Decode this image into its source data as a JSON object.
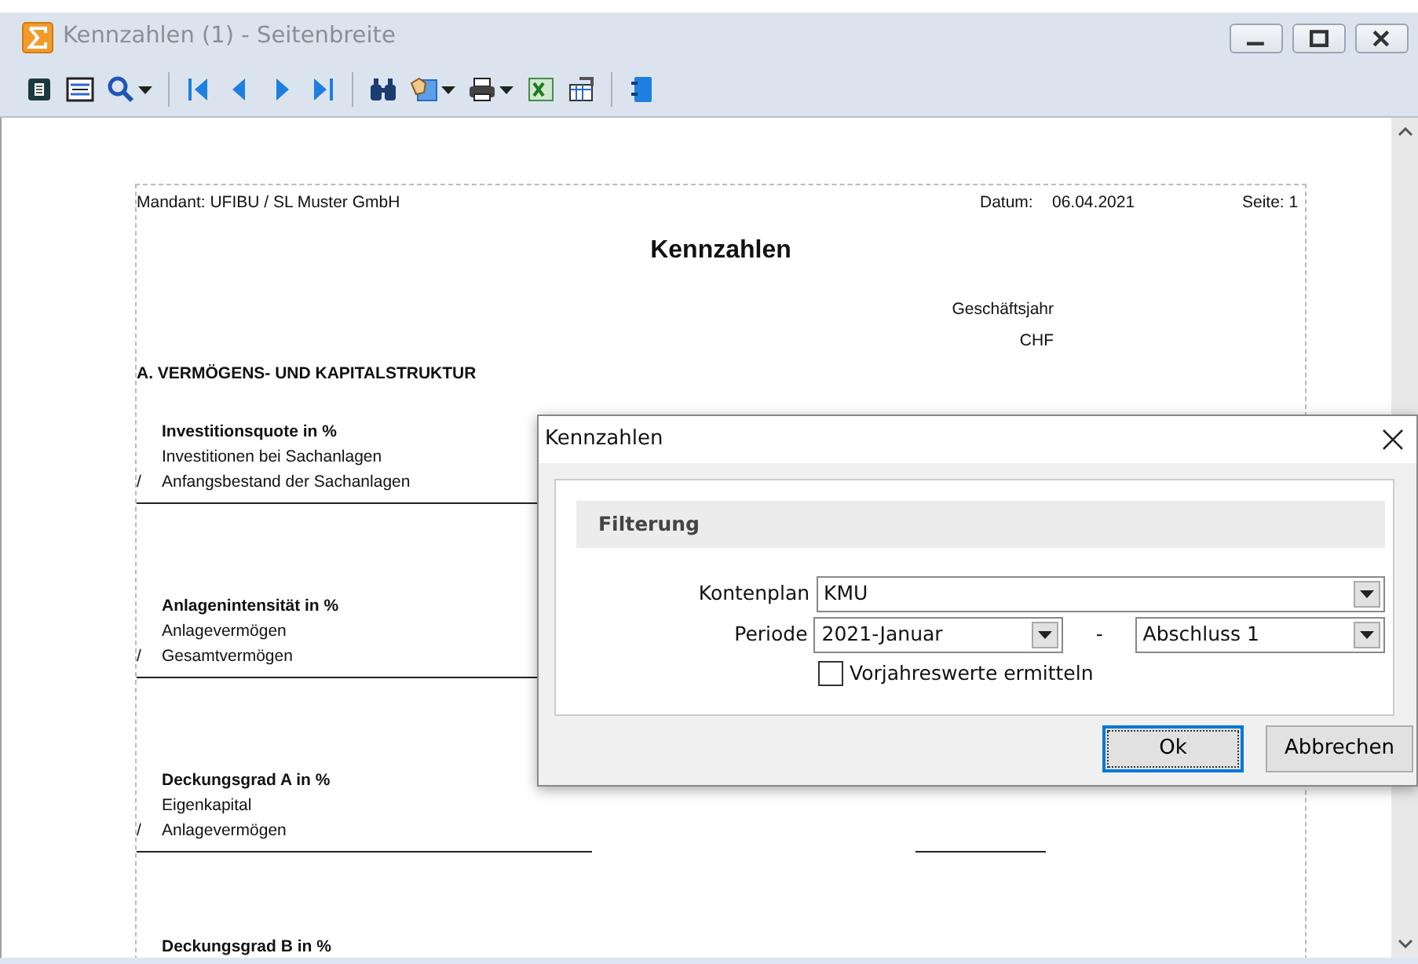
{
  "window": {
    "title": "Kennzahlen (1) - Seitenbreite"
  },
  "toolbar": [
    {
      "kind": "page",
      "menu": false
    },
    {
      "kind": "page-width",
      "menu": false
    },
    {
      "kind": "zoom",
      "menu": true
    },
    {
      "kind": "separator",
      "menu": false
    },
    {
      "kind": "first",
      "menu": false
    },
    {
      "kind": "previous",
      "menu": false
    },
    {
      "kind": "next",
      "menu": false
    },
    {
      "kind": "last",
      "menu": false
    },
    {
      "kind": "separator",
      "menu": false
    },
    {
      "kind": "find",
      "menu": false
    },
    {
      "kind": "export",
      "menu": true
    },
    {
      "kind": "print",
      "menu": true
    },
    {
      "kind": "excel",
      "menu": false
    },
    {
      "kind": "page-setup",
      "menu": false
    },
    {
      "kind": "separator",
      "menu": false
    },
    {
      "kind": "exit",
      "menu": false
    }
  ],
  "report": {
    "client": "Mandant: UFIBU / SL Muster GmbH",
    "date_label": "Datum:",
    "date": "06.04.2021",
    "page": "Seite: 1",
    "title": "Kennzahlen",
    "column_heading": "Geschäftsjahr",
    "currency": "CHF",
    "section": "A.  VERMÖGENS- UND KAPITALSTRUKTUR",
    "ratios": [
      {
        "title": "Investitionsquote in %",
        "numerator": "Investitionen bei Sachanlagen",
        "operator": "/",
        "denominator": "Anfangsbestand der Sachanlagen"
      },
      {
        "title": "Anlagenintensität in %",
        "numerator": "Anlagevermögen",
        "operator": "/",
        "denominator": "Gesamtvermögen"
      },
      {
        "title": "Deckungsgrad A in %",
        "numerator": "Eigenkapital",
        "operator": "/",
        "denominator": "Anlagevermögen"
      },
      {
        "title": "Deckungsgrad B in %"
      }
    ]
  },
  "dialog": {
    "title": "Kennzahlen",
    "group": "Filterung",
    "account_plan": {
      "label": "Kontenplan",
      "value": "KMU"
    },
    "period": {
      "label": "Periode",
      "from": "2021-Januar",
      "separator": "-",
      "to": "Abschluss 1"
    },
    "checkbox": {
      "label": "Vorjahreswerte ermitteln",
      "checked": false
    },
    "buttons": [
      {
        "label": "Ok",
        "default": true
      },
      {
        "label": "Abbrechen",
        "default": false
      }
    ]
  }
}
